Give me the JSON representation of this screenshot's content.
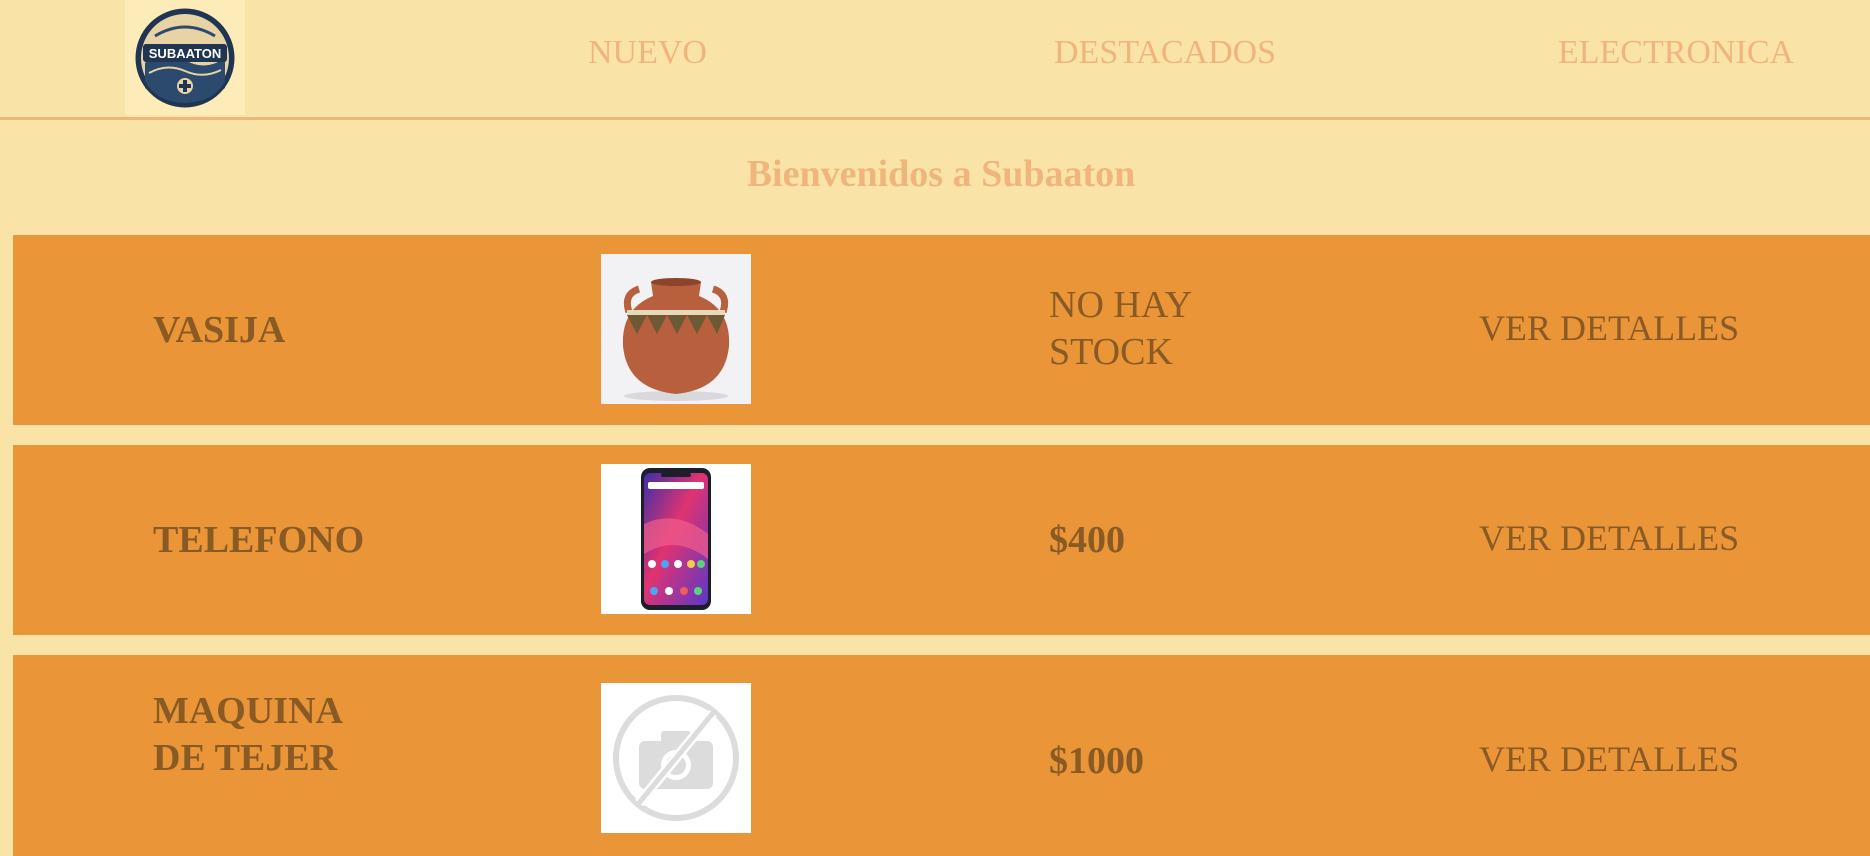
{
  "header": {
    "logo_text": "SUBAATON",
    "nav": [
      {
        "label": "NUEVO"
      },
      {
        "label": "DESTACADOS"
      },
      {
        "label": "ELECTRONICA"
      }
    ]
  },
  "main": {
    "welcome": "Bienvenidos a Subaaton",
    "products": [
      {
        "name": "VASIJA",
        "image": "clay-vase-image",
        "price": "NO HAY STOCK",
        "action": "VER DETALLES"
      },
      {
        "name": "TELEFONO",
        "image": "smartphone-image",
        "price": "$400",
        "action": "VER DETALLES"
      },
      {
        "name": "MAQUINA DE TEJER",
        "image": "no-photo-placeholder-icon",
        "price": "$1000",
        "action": "VER DETALLES"
      }
    ]
  },
  "colors": {
    "page_bg": "#fae3a7",
    "nav_text": "#f0b57c",
    "row_bg": "#e99538",
    "row_text": "#8a5a25"
  }
}
